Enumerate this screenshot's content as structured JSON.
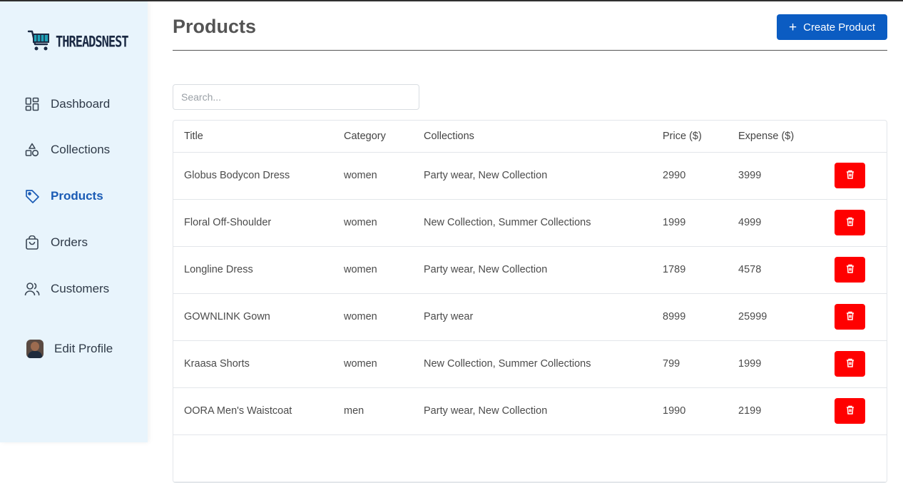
{
  "brand": {
    "name": "THREADSNEST"
  },
  "sidebar": {
    "items": [
      {
        "label": "Dashboard",
        "icon": "dashboard-icon"
      },
      {
        "label": "Collections",
        "icon": "shapes-icon"
      },
      {
        "label": "Products",
        "icon": "tag-icon",
        "active": true
      },
      {
        "label": "Orders",
        "icon": "shopping-bag-icon"
      },
      {
        "label": "Customers",
        "icon": "users-icon"
      }
    ],
    "profile": {
      "label": "Edit Profile",
      "icon": "avatar"
    }
  },
  "header": {
    "title": "Products",
    "create_label": "Create Product"
  },
  "search": {
    "placeholder": "Search...",
    "value": ""
  },
  "table": {
    "columns": [
      "Title",
      "Category",
      "Collections",
      "Price ($)",
      "Expense ($)"
    ],
    "rows": [
      {
        "title": "Globus Bodycon Dress",
        "category": "women",
        "collections": "Party wear, New Collection",
        "price": "2990",
        "expense": "3999"
      },
      {
        "title": "Floral Off-Shoulder",
        "category": "women",
        "collections": "New Collection, Summer Collections",
        "price": "1999",
        "expense": "4999"
      },
      {
        "title": "Longline Dress",
        "category": "women",
        "collections": "Party wear, New Collection",
        "price": "1789",
        "expense": "4578"
      },
      {
        "title": "GOWNLINK Gown",
        "category": "women",
        "collections": "Party wear",
        "price": "8999",
        "expense": "25999"
      },
      {
        "title": "Kraasa Shorts",
        "category": "women",
        "collections": "New Collection, Summer Collections",
        "price": "799",
        "expense": "1999"
      },
      {
        "title": "OORA Men's Waistcoat",
        "category": "men",
        "collections": "Party wear, New Collection",
        "price": "1990",
        "expense": "2199"
      }
    ]
  },
  "colors": {
    "accent": "#0b5cc2",
    "active_nav": "#1a5bb5",
    "danger": "#ff0000",
    "sidebar_bg": "#e8f4fc"
  }
}
